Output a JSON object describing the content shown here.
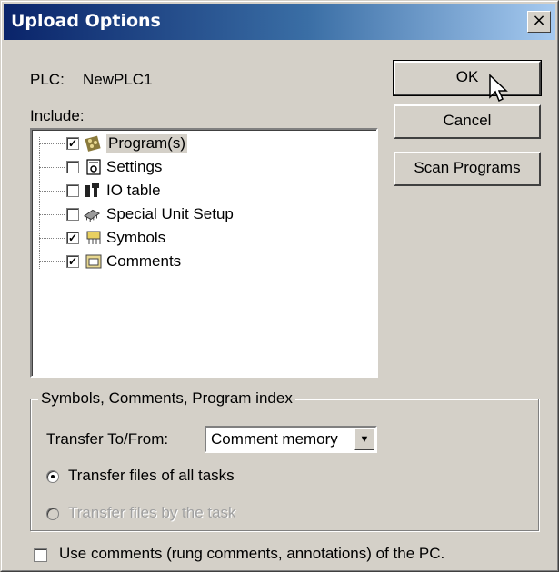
{
  "window": {
    "title": "Upload Options",
    "close_glyph": "×"
  },
  "plc": {
    "label": "PLC:",
    "name": "NewPLC1"
  },
  "include_label": "Include:",
  "buttons": {
    "ok": "OK",
    "cancel": "Cancel",
    "scan": "Scan Programs"
  },
  "tree_items": [
    {
      "label": "Program(s)",
      "checked": true,
      "icon": "program-icon",
      "selected": true
    },
    {
      "label": "Settings",
      "checked": false,
      "icon": "settings-icon",
      "selected": false
    },
    {
      "label": "IO table",
      "checked": false,
      "icon": "io-table-icon",
      "selected": false
    },
    {
      "label": "Special Unit Setup",
      "checked": false,
      "icon": "special-unit-icon",
      "selected": false
    },
    {
      "label": "Symbols",
      "checked": true,
      "icon": "symbols-icon",
      "selected": false
    },
    {
      "label": "Comments",
      "checked": true,
      "icon": "comments-icon",
      "selected": false
    }
  ],
  "group": {
    "title": "Symbols, Comments, Program index",
    "transfer_label": "Transfer To/From:",
    "transfer_value": "Comment memory",
    "radio_all": "Transfer files of all tasks",
    "radio_by_task": "Transfer files by the task",
    "radio_all_selected": true,
    "radio_by_task_enabled": false
  },
  "use_comments": {
    "label": "Use comments (rung comments, annotations) of the PC.",
    "checked": false
  },
  "colors": {
    "title_start": "#0a246a",
    "title_end": "#a6caf0",
    "face": "#d4d0c8"
  }
}
